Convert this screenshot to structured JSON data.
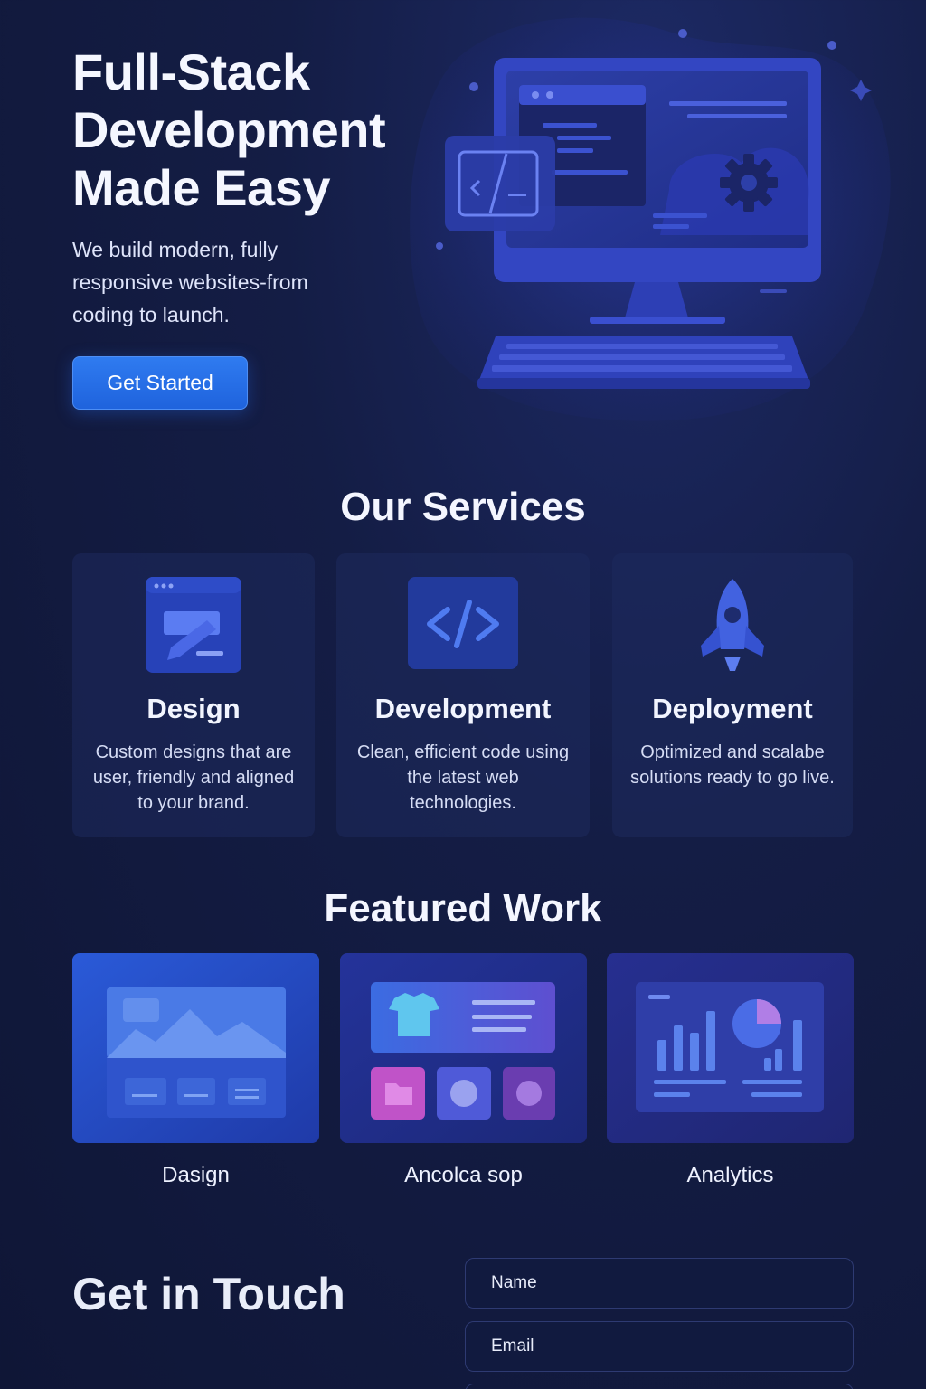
{
  "hero": {
    "title_lines": [
      "Full-Stack",
      "Development",
      "Made Easy"
    ],
    "subtitle": "We build modern, fully responsive websites-from coding to launch.",
    "cta_label": "Get Started",
    "illustration_icon": "desktop-computer-icon"
  },
  "services": {
    "heading": "Our Services",
    "items": [
      {
        "title": "Design",
        "description": "Custom designs that are user, friendly and aligned to your brand.",
        "icon": "design-window-icon"
      },
      {
        "title": "Development",
        "description": "Clean, efficient code using the latest web technologies.",
        "icon": "code-brackets-icon"
      },
      {
        "title": "Deployment",
        "description": "Optimized and scalabe solutions ready to go live.",
        "icon": "rocket-icon"
      }
    ]
  },
  "work": {
    "heading": "Featured Work",
    "items": [
      {
        "label": "Dasign",
        "thumbnail": "landscape-layout-thumbnail"
      },
      {
        "label": "Ancolca sop",
        "thumbnail": "shop-layout-thumbnail"
      },
      {
        "label": "Analytics",
        "thumbnail": "analytics-dashboard-thumbnail"
      }
    ]
  },
  "contact": {
    "heading": "Get in Touch",
    "name_placeholder": "Name",
    "email_placeholder": "Email"
  },
  "colors": {
    "background": "#141d45",
    "accent": "#2f7bf0",
    "card": "#1e2a5c"
  }
}
